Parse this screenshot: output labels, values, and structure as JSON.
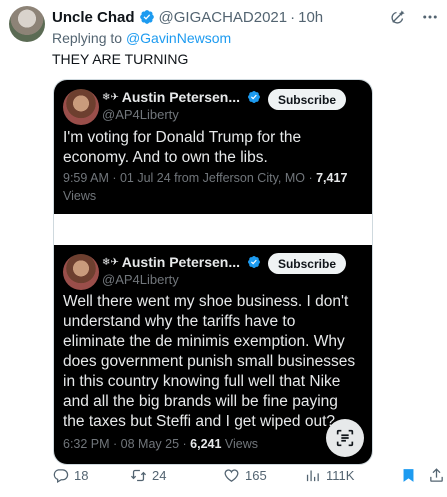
{
  "tweet": {
    "author_name": "Uncle Chad",
    "author_handle": "@GIGACHAD2021",
    "separator": "·",
    "time": "10h",
    "replying_prefix": "Replying to",
    "replying_to": "@GavinNewsom",
    "text": "THEY ARE TURNING"
  },
  "embedded": [
    {
      "name": "Austin Petersen...",
      "handle": "@AP4Liberty",
      "subscribe_label": "Subscribe",
      "text": "I'm voting for Donald Trump for the economy. And to own the libs.",
      "meta_time": "9:59 AM · 01 Jul 24 from Jefferson City, MO · ",
      "views_count": "7,417",
      "views_label": "Views"
    },
    {
      "name": "Austin Petersen...",
      "handle": "@AP4Liberty",
      "subscribe_label": "Subscribe",
      "text": "Well there went my shoe business. I don't understand why the tariffs have to eliminate the de minimis exemption. Why does government punish small businesses in this country knowing full well that Nike and all the big brands will be fine paying the taxes but Steffi and I get wiped out?",
      "meta_time": "6:32 PM · 08 May 25 · ",
      "views_count": "6,241",
      "views_label": "Views"
    }
  ],
  "actions": {
    "replies": "18",
    "retweets": "24",
    "likes": "165",
    "views": "111K"
  },
  "colors": {
    "link": "#1d9bf0",
    "secondary_text": "#536471",
    "card_background": "#000000",
    "verified": "#1d9bf0",
    "bookmark_active": "#1d9bf0"
  },
  "icons": [
    "grok-icon",
    "more-icon",
    "verified-badge-icon",
    "reply-icon",
    "retweet-icon",
    "like-icon",
    "views-icon",
    "bookmark-icon",
    "share-icon",
    "text-scan-icon"
  ]
}
